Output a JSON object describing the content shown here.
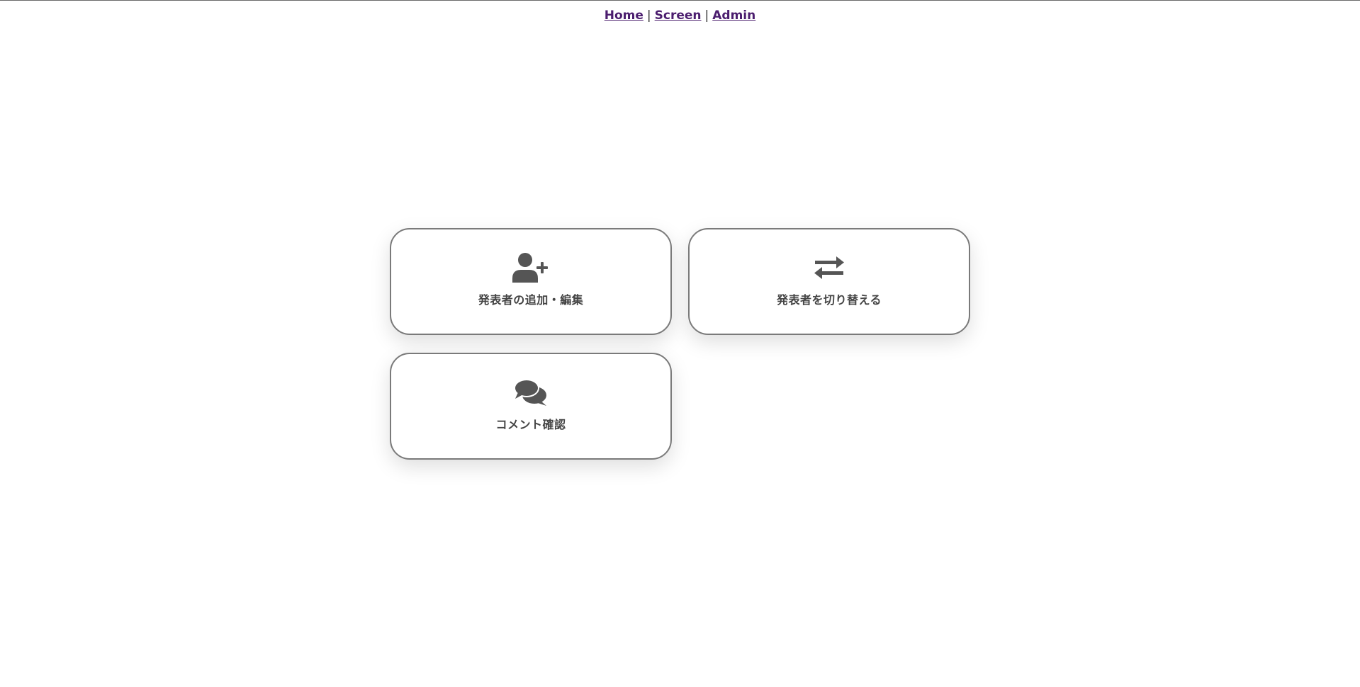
{
  "nav": {
    "home": "Home",
    "separator": "|",
    "screen": "Screen",
    "admin": "Admin"
  },
  "cards": [
    {
      "label": "発表者の追加・編集",
      "icon": "user-plus-icon"
    },
    {
      "label": "発表者を切り替える",
      "icon": "exchange-arrows-icon"
    },
    {
      "label": "コメント確認",
      "icon": "comments-icon"
    }
  ],
  "colors": {
    "icon": "#555555",
    "link": "#4b1d6e",
    "card_border": "#7a7a7a"
  }
}
